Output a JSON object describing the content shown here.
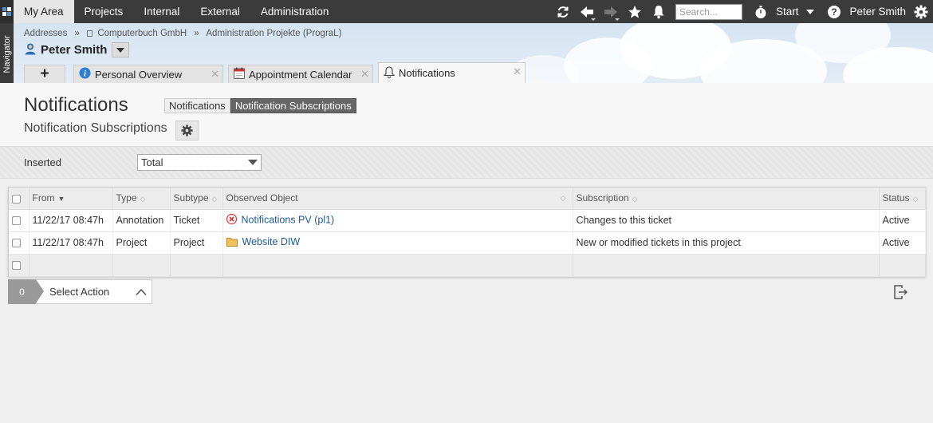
{
  "topnav": {
    "items": [
      "My Area",
      "Projects",
      "Internal",
      "External",
      "Administration"
    ],
    "search_placeholder": "Search...",
    "start_label": "Start",
    "user_label": "Peter Smith",
    "icons": [
      "refresh-icon",
      "back-arrow-icon",
      "forward-arrow-icon",
      "star-icon",
      "bell-icon",
      "stopwatch-icon",
      "help-icon",
      "gear-icon"
    ]
  },
  "sidebar": {
    "label": "Navigator"
  },
  "breadcrumb": [
    "Addresses",
    "Computerbuch GmbH",
    "Administration Projekte (PrograL)"
  ],
  "person": {
    "name": "Peter Smith"
  },
  "tabs": [
    {
      "label": "Personal Overview",
      "icon": "info-icon"
    },
    {
      "label": "Appointment Calendar",
      "icon": "calendar-icon"
    },
    {
      "label": "Notifications",
      "icon": "bell-icon"
    }
  ],
  "page": {
    "title": "Notifications",
    "subtitle": "Notification Subscriptions",
    "view_tabs": [
      "Notifications",
      "Notification Subscriptions"
    ]
  },
  "filter": {
    "label": "Inserted",
    "value": "Total"
  },
  "table": {
    "columns": [
      "From",
      "Type",
      "Subtype",
      "Observed Object",
      "Subscription",
      "Status"
    ],
    "rows": [
      {
        "from": "11/22/17 08:47h",
        "type": "Annotation",
        "subtype": "Ticket",
        "object": "Notifications PV (pl1)",
        "object_icon": "ticket-icon",
        "subscription": "Changes to this ticket",
        "status": "Active"
      },
      {
        "from": "11/22/17 08:47h",
        "type": "Project",
        "subtype": "Project",
        "object": "Website DIW",
        "object_icon": "folder-icon",
        "subscription": "New or modified tickets in this project",
        "status": "Active"
      }
    ]
  },
  "actions": {
    "count": "0",
    "label": "Select Action"
  },
  "colors": {
    "topbar": "#3b3b3b",
    "link": "#1e5a96",
    "selected_tab": "#666666"
  }
}
